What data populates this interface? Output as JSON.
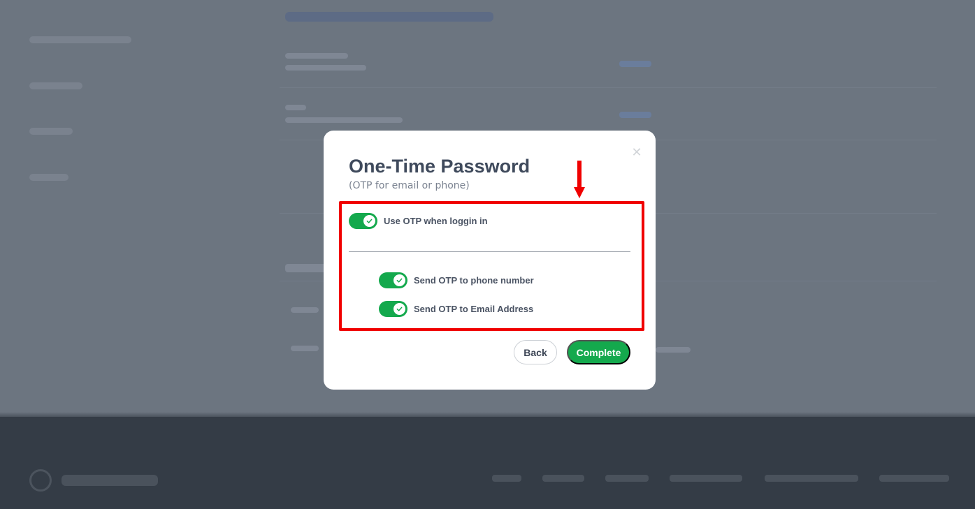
{
  "modal": {
    "title": "One-Time Password",
    "subtitle": "(OTP for email or phone)",
    "close_icon": "close-icon",
    "main_toggle": {
      "label": "Use OTP when loggin in",
      "checked": true
    },
    "sub_toggles": [
      {
        "label": "Send OTP to phone number",
        "checked": true
      },
      {
        "label": "Send OTP to Email Address",
        "checked": true
      }
    ],
    "buttons": {
      "back": "Back",
      "complete": "Complete"
    }
  },
  "colors": {
    "accent_green": "#14a94d",
    "highlight_red": "#f00000",
    "overlay": "#6c7580",
    "footer": "#343c46",
    "title_text": "#3f4a5c"
  }
}
